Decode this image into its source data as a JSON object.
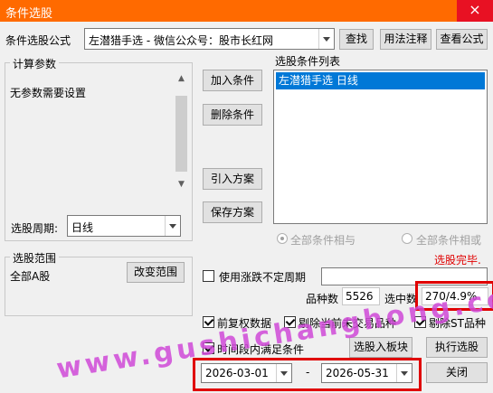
{
  "window": {
    "title": "条件选股",
    "close_glyph": "×"
  },
  "formula": {
    "label": "条件选股公式",
    "value": "左潜猎手选  -  微信公众号：股市长红网",
    "find_label": "查找",
    "usage_label": "用法注释",
    "view_label": "查看公式"
  },
  "params": {
    "title": "计算参数",
    "text": "无参数需要设置",
    "period_label": "选股周期:",
    "period_value": "日线"
  },
  "actions": {
    "add": "加入条件",
    "delete": "删除条件",
    "import": "引入方案",
    "save": "保存方案"
  },
  "condition_list": {
    "title": "选股条件列表",
    "items": [
      "左潜猎手选  日线"
    ]
  },
  "logic": {
    "and_label": "全部条件相与",
    "or_label": "全部条件相或"
  },
  "status": {
    "text": "选股完毕.",
    "color": "#e00000"
  },
  "scope": {
    "title": "选股范围",
    "value": "全部A股",
    "change_label": "改变范围"
  },
  "unfixed": {
    "label": "使用涨跌不定周期",
    "checked": false
  },
  "stats": {
    "count_label": "品种数",
    "count_value": "5526",
    "selected_label": "选中数",
    "selected_value": "270/4.9%"
  },
  "options": {
    "fq_label": "前复权数据",
    "exclude_untraded_label": "剔除当前未交易品种",
    "exclude_st_label": "剔除ST品种",
    "period_cond_label": "时间段内满足条件"
  },
  "bottom": {
    "to_block_label": "选股入板块",
    "exec_label": "执行选股",
    "close_label": "关闭",
    "start_date": "2026-03-01",
    "dash": "-",
    "end_date": "2026-05-31"
  },
  "watermark": "www.gushichanghong.com",
  "colors": {
    "accent": "#ff6a00",
    "selection": "#0078d7",
    "highlight": "#e00000"
  }
}
